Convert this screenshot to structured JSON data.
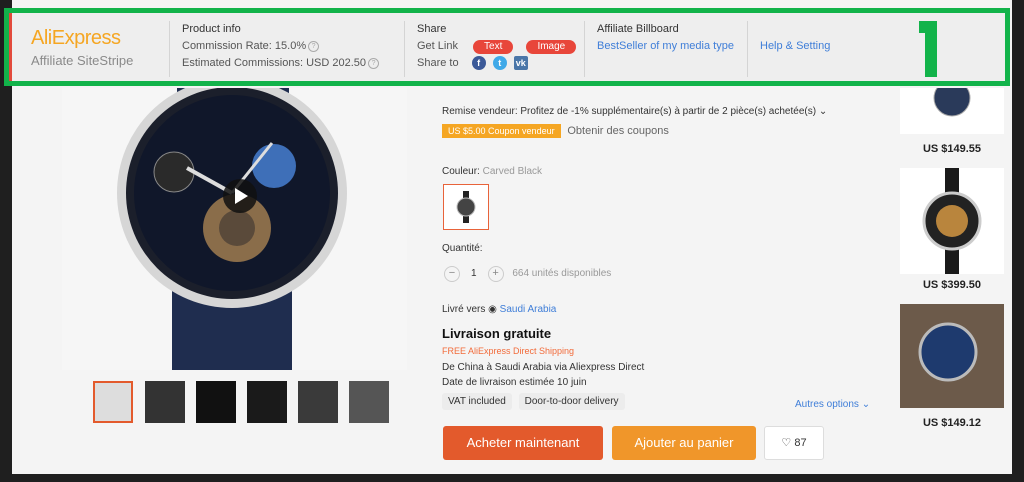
{
  "affiliate": {
    "logo": "AliExpress",
    "subtitle": "Affiliate SiteStripe",
    "product_info": {
      "title": "Product info",
      "commission_rate_label": "Commission Rate: 15.0%",
      "estimated_label": "Estimated Commissions: USD 202.50"
    },
    "share": {
      "title": "Share",
      "get_link_label": "Get Link",
      "text_button": "Text",
      "image_button": "Image",
      "share_to_label": "Share to"
    },
    "billboard": {
      "title": "Affiliate Billboard",
      "link": "BestSeller of my media type"
    },
    "help": "Help & Setting",
    "overlay_number": "1"
  },
  "product": {
    "promo": "Remise vendeur: Profitez de -1% supplémentaire(s) à partir de 2 pièce(s) achetée(s)",
    "coupon": "US $5.00 Coupon vendeur",
    "coupon_link": "Obtenir des coupons",
    "color_label": "Couleur:",
    "color_value": "Carved Black",
    "quantity_label": "Quantité:",
    "quantity_value": "1",
    "stock": "664 unités disponibles",
    "ship_to_label": "Livré vers",
    "ship_to_country": "Saudi Arabia",
    "shipping_title": "Livraison gratuite",
    "shipping_service": "FREE AliExpress Direct Shipping",
    "shipping_route": "De China à Saudi Arabia via Aliexpress Direct",
    "delivery_date": "Date de livraison estimée 10 juin",
    "tags": [
      "VAT included",
      "Door-to-door delivery"
    ],
    "more_options": "Autres options",
    "buy_now": "Acheter maintenant",
    "add_to_cart": "Ajouter au panier",
    "wishlist_count": "87"
  },
  "related": [
    {
      "price": "US $149.55"
    },
    {
      "price": "US $399.50"
    },
    {
      "price": "US $149.12"
    }
  ],
  "colors": {
    "accent": "#e24a3b",
    "brand_orange": "#f5a623",
    "frame_green": "#12b34a",
    "link_blue": "#3f7ed8"
  }
}
